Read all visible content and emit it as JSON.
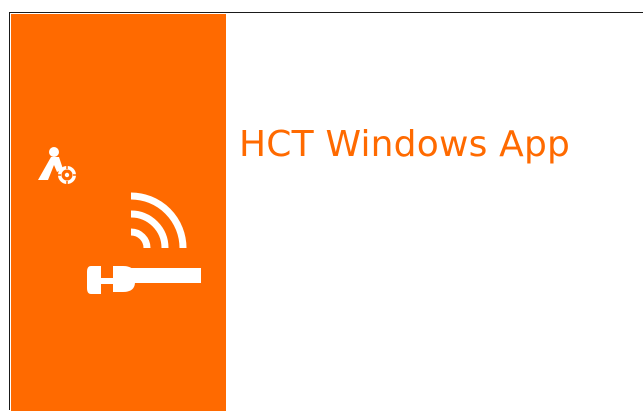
{
  "app": {
    "title": "HCT Windows App"
  },
  "colors": {
    "brand_orange": "#ff6a00",
    "background": "#ffffff",
    "window_border": "#1a1a1a",
    "icon_fill": "#ffffff"
  },
  "icons": {
    "small_logo": "person-with-gear-icon",
    "main_logo": "wrench-wireless-signal-icon"
  }
}
